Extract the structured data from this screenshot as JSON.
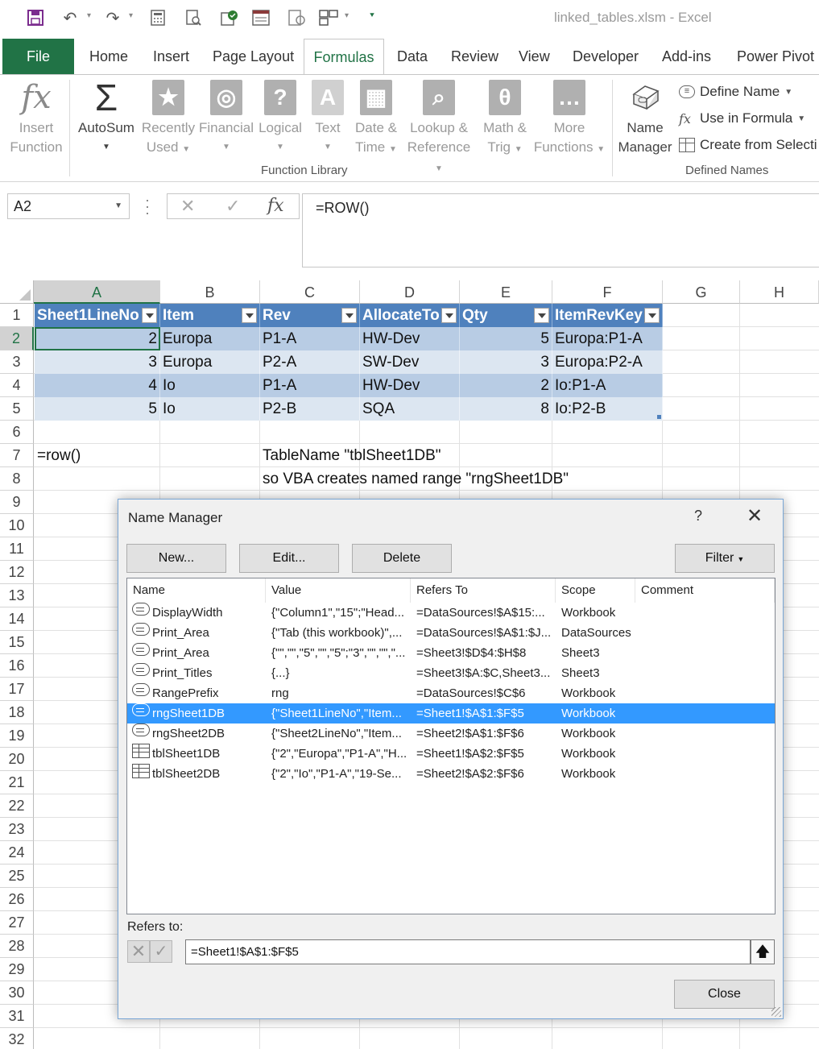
{
  "window": {
    "title": "linked_tables.xlsm  -  Excel"
  },
  "qat": {
    "icons": [
      "save-icon",
      "undo-icon",
      "redo-icon",
      "calculator-icon",
      "print-preview-icon",
      "publish-icon",
      "form-icon",
      "refresh-icon",
      "window-layout-icon",
      "customize-icon"
    ]
  },
  "tabs": [
    "File",
    "Home",
    "Insert",
    "Page Layout",
    "Formulas",
    "Data",
    "Review",
    "View",
    "Developer",
    "Add-ins",
    "Power Pivot"
  ],
  "active_tab": "Formulas",
  "ribbon": {
    "insert_function": {
      "line1": "Insert",
      "line2": "Function"
    },
    "autosum": {
      "line1": "AutoSum"
    },
    "recently_used": {
      "line1": "Recently",
      "line2": "Used"
    },
    "financial": {
      "line1": "Financial"
    },
    "logical": {
      "line1": "Logical"
    },
    "text": {
      "line1": "Text"
    },
    "date_time": {
      "line1": "Date &",
      "line2": "Time"
    },
    "lookup": {
      "line1": "Lookup &",
      "line2": "Reference"
    },
    "math": {
      "line1": "Math &",
      "line2": "Trig"
    },
    "more": {
      "line1": "More",
      "line2": "Functions"
    },
    "function_library_label": "Function Library",
    "name_manager": {
      "line1": "Name",
      "line2": "Manager"
    },
    "define_name": "Define Name",
    "use_in_formula": "Use in Formula",
    "create_from_selection": "Create from Selecti",
    "defined_names_label": "Defined Names"
  },
  "formula_bar": {
    "name_box": "A2",
    "formula": "=ROW()"
  },
  "grid": {
    "columns": [
      "A",
      "B",
      "C",
      "D",
      "E",
      "F",
      "G",
      "H"
    ],
    "rows": [
      "1",
      "2",
      "3",
      "4",
      "5",
      "6",
      "7",
      "8",
      "9",
      "10",
      "11",
      "12",
      "13",
      "14",
      "15",
      "16",
      "17",
      "18",
      "19",
      "20",
      "21",
      "22",
      "23",
      "24",
      "25",
      "26",
      "27",
      "28",
      "29",
      "30",
      "31",
      "32"
    ],
    "table_headers": [
      "Sheet1LineNo",
      "Item",
      "Rev",
      "AllocateTo",
      "Qty",
      "ItemRevKey"
    ],
    "table_rows": [
      [
        "2",
        "Europa",
        "P1-A",
        "HW-Dev",
        "5",
        "Europa:P1-A"
      ],
      [
        "3",
        "Europa",
        "P2-A",
        "SW-Dev",
        "3",
        "Europa:P2-A"
      ],
      [
        "4",
        "Io",
        "P1-A",
        "HW-Dev",
        "2",
        "Io:P1-A"
      ],
      [
        "5",
        "Io",
        "P2-B",
        "SQA",
        "8",
        "Io:P2-B"
      ]
    ],
    "a7": "=row()",
    "c7": "TableName \"tblSheet1DB\"",
    "c8": "so VBA creates named range \"rngSheet1DB\""
  },
  "name_manager": {
    "title": "Name Manager",
    "help": "?",
    "buttons": {
      "new": "New...",
      "edit": "Edit...",
      "delete": "Delete",
      "filter": "Filter"
    },
    "columns": [
      "Name",
      "Value",
      "Refers To",
      "Scope",
      "Comment"
    ],
    "rows": [
      {
        "icon": "named-range-icon",
        "name": "DisplayWidth",
        "value": "{\"Column1\",\"15\";\"Head...",
        "refers_to": "=DataSources!$A$15:...",
        "scope": "Workbook",
        "comment": ""
      },
      {
        "icon": "named-range-icon",
        "name": "Print_Area",
        "value": "{\"Tab (this workbook)\",...",
        "refers_to": "=DataSources!$A$1:$J...",
        "scope": "DataSources",
        "comment": ""
      },
      {
        "icon": "named-range-icon",
        "name": "Print_Area",
        "value": "{\"\",\"\",\"5\",\"\",\"5\";\"3\",\"\",\"\",\"...",
        "refers_to": "=Sheet3!$D$4:$H$8",
        "scope": "Sheet3",
        "comment": ""
      },
      {
        "icon": "named-range-icon",
        "name": "Print_Titles",
        "value": "{...}",
        "refers_to": "=Sheet3!$A:$C,Sheet3...",
        "scope": "Sheet3",
        "comment": ""
      },
      {
        "icon": "named-range-icon",
        "name": "RangePrefix",
        "value": "rng",
        "refers_to": "=DataSources!$C$6",
        "scope": "Workbook",
        "comment": ""
      },
      {
        "icon": "named-range-icon",
        "name": "rngSheet1DB",
        "value": "{\"Sheet1LineNo\",\"Item...",
        "refers_to": "=Sheet1!$A$1:$F$5",
        "scope": "Workbook",
        "comment": ""
      },
      {
        "icon": "named-range-icon",
        "name": "rngSheet2DB",
        "value": "{\"Sheet2LineNo\",\"Item...",
        "refers_to": "=Sheet2!$A$1:$F$6",
        "scope": "Workbook",
        "comment": ""
      },
      {
        "icon": "table-icon",
        "name": "tblSheet1DB",
        "value": "{\"2\",\"Europa\",\"P1-A\",\"H...",
        "refers_to": "=Sheet1!$A$2:$F$5",
        "scope": "Workbook",
        "comment": ""
      },
      {
        "icon": "table-icon",
        "name": "tblSheet2DB",
        "value": "{\"2\",\"Io\",\"P1-A\",\"19-Se...",
        "refers_to": "=Sheet2!$A$2:$F$6",
        "scope": "Workbook",
        "comment": ""
      }
    ],
    "selected_row": 5,
    "refers_to_label": "Refers to:",
    "refers_to_value": "=Sheet1!$A$1:$F$5",
    "close": "Close"
  },
  "colors": {
    "excel_green": "#217346",
    "table_header": "#4f81bd",
    "band_dark": "#b8cce4",
    "band_light": "#dce6f1",
    "selection": "#3399ff"
  }
}
